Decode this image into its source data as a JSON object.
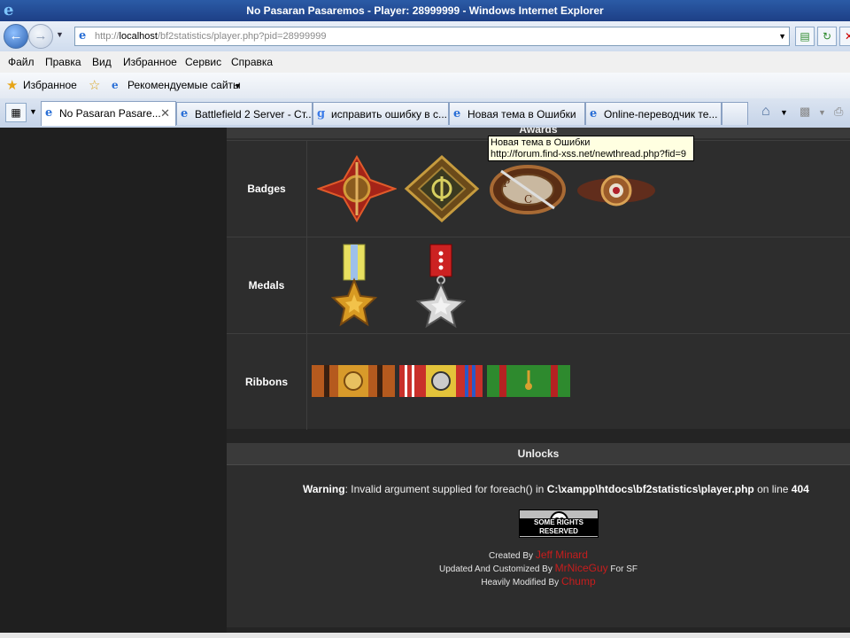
{
  "window": {
    "title": "No Pasaran Pasaremos - Player: 28999999 - Windows Internet Explorer"
  },
  "address": {
    "prefix": "http://",
    "host": "localhost",
    "path": "/bf2statistics/player.php?pid=28999999"
  },
  "menu": [
    "Файл",
    "Правка",
    "Вид",
    "Избранное",
    "Сервис",
    "Справка"
  ],
  "favorites": {
    "label": "Избранное",
    "suggested": "Рекомендуемые сайты"
  },
  "tabs": [
    {
      "label": "No Pasaran Pasare...",
      "active": true
    },
    {
      "label": "Battlefield 2 Server - Ст...",
      "active": false
    },
    {
      "label": "исправить ошибку в с...",
      "active": false
    },
    {
      "label": "Новая тема в Ошибки",
      "active": false
    },
    {
      "label": "Online-переводчик те...",
      "active": false
    }
  ],
  "tooltip": {
    "line1": "Новая тема в Ошибки",
    "line2": "http://forum.find-xss.net/newthread.php?fid=9"
  },
  "awards": {
    "heading": "Awards",
    "rows": [
      {
        "label": "Badges"
      },
      {
        "label": "Medals"
      },
      {
        "label": "Ribbons"
      }
    ]
  },
  "unlocks": {
    "heading": "Unlocks",
    "warning_label": "Warning",
    "warning_text": ": Invalid argument supplied for foreach() in ",
    "warning_path": "C:\\xampp\\htdocs\\bf2statistics\\player.php",
    "warning_online": " on line ",
    "warning_line": "404"
  },
  "license": {
    "symbol": "cc",
    "text": "SOME RIGHTS RESERVED"
  },
  "credits": [
    {
      "prefix": "Created By ",
      "name": "Jeff Minard",
      "suffix": ""
    },
    {
      "prefix": "Updated And Customized By ",
      "name": "MrNiceGuy",
      "suffix": " For SF"
    },
    {
      "prefix": "Heavily Modified By ",
      "name": "Chump",
      "suffix": ""
    }
  ]
}
